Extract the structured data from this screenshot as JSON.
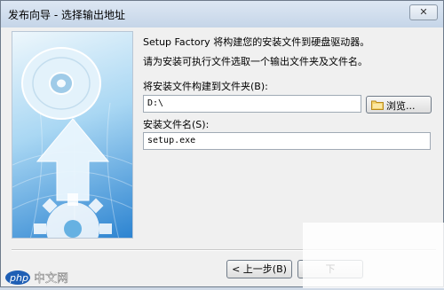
{
  "window": {
    "title": "发布向导 - 选择输出地址",
    "close_glyph": "✕"
  },
  "main": {
    "intro_line1": "Setup Factory 将构建您的安装文件到硬盘驱动器。",
    "intro_line2": "请为安装可执行文件选取一个输出文件夹及文件名。",
    "folder_label": "将安装文件构建到文件夹(B):",
    "folder_value": "D:\\",
    "browse_label": "浏览...",
    "filename_label": "安装文件名(S):",
    "filename_value": "setup.exe"
  },
  "footer": {
    "back_label": "< 上一步(B)",
    "next_label": "下"
  },
  "brand": {
    "logo_text": "php 中文网"
  },
  "icons": [
    "disc-icon",
    "up-arrow-icon",
    "gear-icon",
    "folder-icon",
    "close-icon"
  ]
}
